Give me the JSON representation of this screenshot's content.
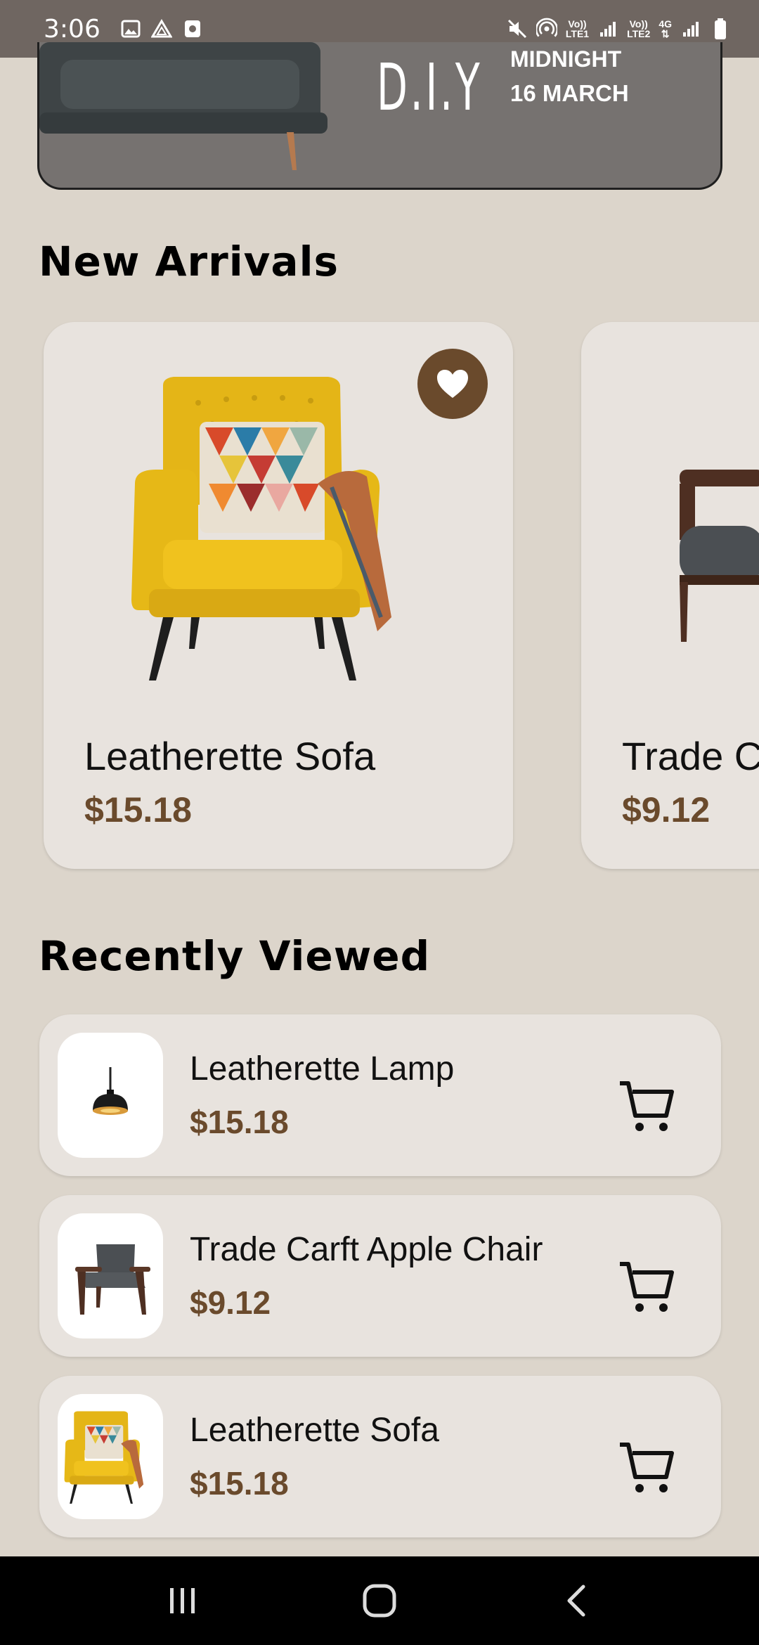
{
  "status_bar": {
    "time": "3:06",
    "sim1": [
      "Vo))",
      "LTE1"
    ],
    "sim2": [
      "Vo))",
      "LTE2"
    ],
    "network": "4G"
  },
  "banner": {
    "brand": "D.I.Y",
    "line1": "MIDNIGHT",
    "line2": "16 MARCH"
  },
  "new_arrivals": {
    "title": "New Arrivals",
    "products": [
      {
        "name": "Leatherette Sofa",
        "price": "$15.18",
        "favorite": true
      },
      {
        "name": "Trade Carft Apple Chair",
        "price": "$9.12",
        "favorite": false
      }
    ]
  },
  "recently_viewed": {
    "title": "Recently Viewed",
    "items": [
      {
        "name": "Leatherette Lamp",
        "price": "$15.18",
        "thumb": "pendant-lamp"
      },
      {
        "name": "Trade Carft Apple Chair",
        "price": "$9.12",
        "thumb": "wooden-chair"
      },
      {
        "name": "Leatherette Sofa",
        "price": "$15.18",
        "thumb": "yellow-armchair"
      }
    ]
  },
  "colors": {
    "background": "#dcd5cb",
    "card": "#e8e3de",
    "accent_brown": "#6a4a2c",
    "status_bar": "#6f6661"
  }
}
